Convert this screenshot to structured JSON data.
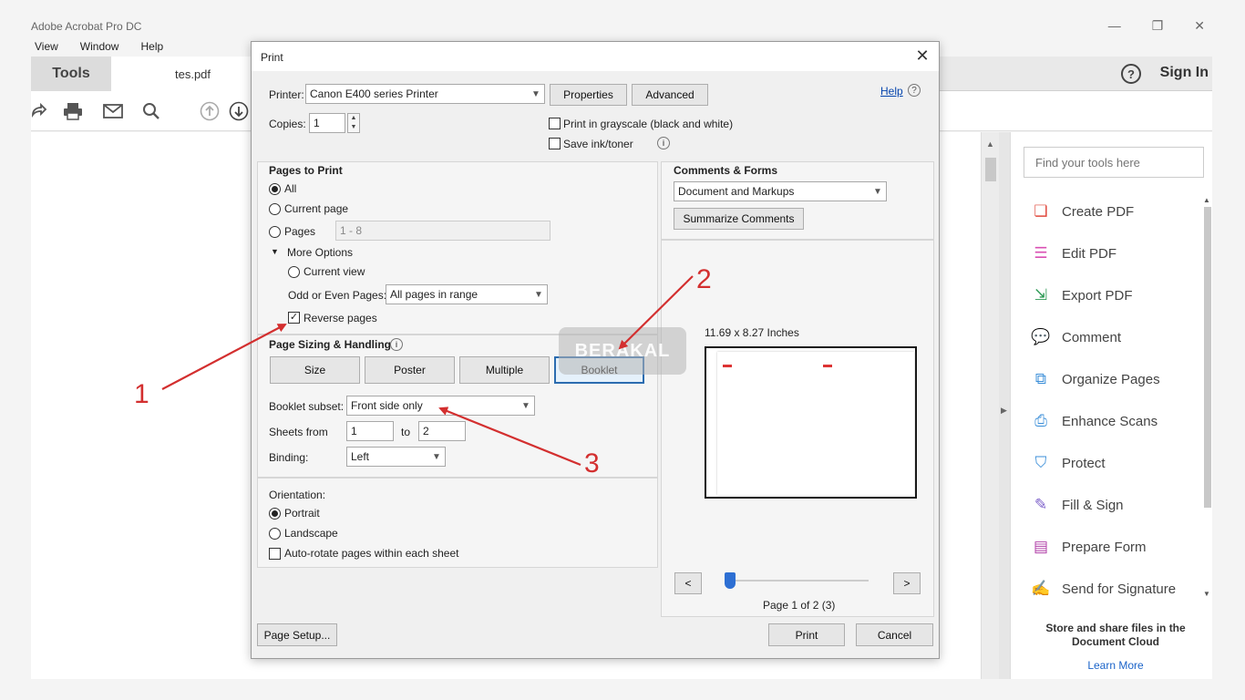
{
  "app": {
    "title": "Adobe Acrobat Pro DC",
    "menu": [
      "View",
      "Window",
      "Help"
    ],
    "window_controls": [
      "—",
      "❐",
      "✕"
    ],
    "tools_tab": "Tools",
    "file_tab": "tes.pdf",
    "help_icon": "?",
    "sign_in": "Sign In",
    "toolbar_icons": [
      "share-icon",
      "print-icon",
      "mail-icon",
      "search-icon",
      "page-up-icon",
      "page-down-icon"
    ]
  },
  "tools_pane": {
    "search_placeholder": "Find your tools here",
    "items": [
      {
        "label": "Create PDF",
        "icon": "create-pdf-icon",
        "color": "#e0493e"
      },
      {
        "label": "Edit PDF",
        "icon": "edit-pdf-icon",
        "color": "#d94fb3"
      },
      {
        "label": "Export PDF",
        "icon": "export-pdf-icon",
        "color": "#2e9a55"
      },
      {
        "label": "Comment",
        "icon": "comment-icon",
        "color": "#f0a500"
      },
      {
        "label": "Organize Pages",
        "icon": "organize-pages-icon",
        "color": "#3a8ed8"
      },
      {
        "label": "Enhance Scans",
        "icon": "enhance-scans-icon",
        "color": "#3a8ed8"
      },
      {
        "label": "Protect",
        "icon": "protect-icon",
        "color": "#3a8ed8"
      },
      {
        "label": "Fill & Sign",
        "icon": "fill-sign-icon",
        "color": "#7b5ec9"
      },
      {
        "label": "Prepare Form",
        "icon": "prepare-form-icon",
        "color": "#b13fa8"
      },
      {
        "label": "Send for Signature",
        "icon": "send-signature-icon",
        "color": "#5b5ec9"
      }
    ],
    "cloud_text": "Store and share files in the Document Cloud",
    "learn_more": "Learn More"
  },
  "print_dialog": {
    "title": "Print",
    "printer_label": "Printer:",
    "printer_value": "Canon E400 series Printer",
    "properties": "Properties",
    "advanced": "Advanced",
    "help": "Help",
    "copies_label": "Copies:",
    "copies_value": "1",
    "grayscale": "Print in grayscale (black and white)",
    "save_ink": "Save ink/toner",
    "pages_to_print": {
      "title": "Pages to Print",
      "all": "All",
      "current_page": "Current page",
      "pages": "Pages",
      "pages_value": "1 - 8",
      "more_options": "More Options",
      "current_view": "Current view",
      "odd_even_label": "Odd or Even Pages:",
      "odd_even_value": "All pages in range",
      "reverse_pages": "Reverse pages"
    },
    "sizing": {
      "title": "Page Sizing & Handling",
      "size": "Size",
      "poster": "Poster",
      "multiple": "Multiple",
      "booklet": "Booklet",
      "booklet_subset_label": "Booklet subset:",
      "booklet_subset_value": "Front side only",
      "sheets_from_label": "Sheets from",
      "sheets_from_value": "1",
      "to_label": "to",
      "sheets_to_value": "2",
      "binding_label": "Binding:",
      "binding_value": "Left"
    },
    "orientation": {
      "title": "Orientation:",
      "portrait": "Portrait",
      "landscape": "Landscape",
      "auto_rotate": "Auto-rotate pages within each sheet"
    },
    "comments_forms": {
      "title": "Comments & Forms",
      "value": "Document and Markups",
      "summarize": "Summarize Comments"
    },
    "preview": {
      "size_text": "11.69 x 8.27 Inches",
      "prev": "<",
      "next": ">",
      "page_info": "Page 1 of 2 (3)"
    },
    "page_setup": "Page Setup...",
    "print": "Print",
    "cancel": "Cancel"
  },
  "annotations": {
    "watermark": "BERAKAL",
    "labels": [
      "1",
      "2",
      "3"
    ],
    "arrow_color": "#d32f2f"
  }
}
